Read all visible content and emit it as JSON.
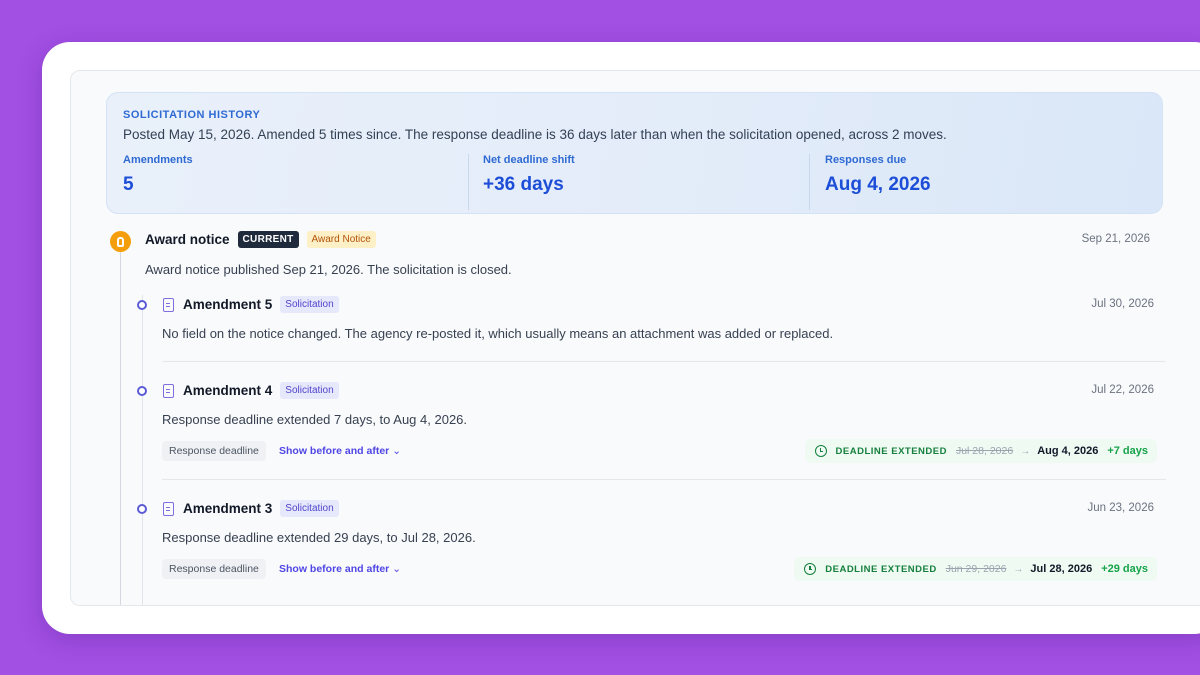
{
  "summary": {
    "label": "SOLICITATION HISTORY",
    "text": "Posted May 15, 2026. Amended 5 times since. The response deadline is 36 days later than when the solicitation opened, across 2 moves.",
    "stats": [
      {
        "label": "Amendments",
        "value": "5"
      },
      {
        "label": "Net deadline shift",
        "value": "+36 days"
      },
      {
        "label": "Responses due",
        "value": "Aug 4, 2026"
      }
    ]
  },
  "award": {
    "title": "Award notice",
    "current_badge": "CURRENT",
    "type_badge": "Award Notice",
    "date": "Sep 21, 2026",
    "description": "Award notice published Sep 21, 2026. The solicitation is closed."
  },
  "amendments": [
    {
      "title": "Amendment 5",
      "badge": "Solicitation",
      "date": "Jul 30, 2026",
      "description": "No field on the notice changed. The agency re-posted it, which usually means an attachment was added or replaced."
    },
    {
      "title": "Amendment 4",
      "badge": "Solicitation",
      "date": "Jul 22, 2026",
      "description": "Response deadline extended 7 days, to Aug 4, 2026.",
      "field": "Response deadline",
      "toggle": "Show before and after",
      "change_label": "DEADLINE EXTENDED",
      "old_value": "Jul 28, 2026",
      "new_value": "Aug 4, 2026",
      "delta": "+7 days"
    },
    {
      "title": "Amendment 3",
      "badge": "Solicitation",
      "date": "Jun 23, 2026",
      "description": "Response deadline extended 29 days, to Jul 28, 2026.",
      "field": "Response deadline",
      "toggle": "Show before and after",
      "change_label": "DEADLINE EXTENDED",
      "old_value": "Jun 29, 2026",
      "new_value": "Jul 28, 2026",
      "delta": "+29 days"
    }
  ],
  "icons": {
    "award": "award-icon",
    "document": "document-icon",
    "clock": "clock-icon",
    "chevron": "chevron-down-icon",
    "arrow": "arrow-right-icon"
  },
  "colors": {
    "background": "#a24fe4",
    "accent": "#1d4ed8",
    "award": "#f59e0b",
    "success": "#15803d",
    "link": "#4f46e5"
  }
}
